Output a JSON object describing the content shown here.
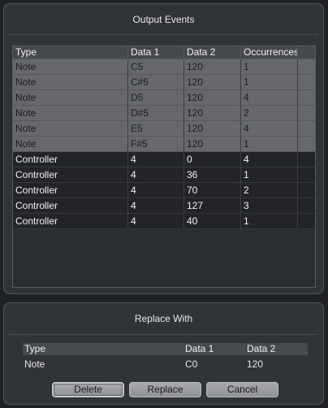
{
  "output_events": {
    "title": "Output Events",
    "columns": [
      "Type",
      "Data 1",
      "Data 2",
      "Occurrences"
    ],
    "rows": [
      {
        "type": "Note",
        "data1": "C5",
        "data2": "120",
        "occurrences": "1"
      },
      {
        "type": "Note",
        "data1": "C#5",
        "data2": "120",
        "occurrences": "1"
      },
      {
        "type": "Note",
        "data1": "D5",
        "data2": "120",
        "occurrences": "4"
      },
      {
        "type": "Note",
        "data1": "D#5",
        "data2": "120",
        "occurrences": "2"
      },
      {
        "type": "Note",
        "data1": "E5",
        "data2": "120",
        "occurrences": "4"
      },
      {
        "type": "Note",
        "data1": "F#5",
        "data2": "120",
        "occurrences": "1"
      },
      {
        "type": "Controller",
        "data1": "4",
        "data2": "0",
        "occurrences": "4"
      },
      {
        "type": "Controller",
        "data1": "4",
        "data2": "36",
        "occurrences": "1"
      },
      {
        "type": "Controller",
        "data1": "4",
        "data2": "70",
        "occurrences": "2"
      },
      {
        "type": "Controller",
        "data1": "4",
        "data2": "127",
        "occurrences": "3"
      },
      {
        "type": "Controller",
        "data1": "4",
        "data2": "40",
        "occurrences": "1"
      }
    ]
  },
  "replace_with": {
    "title": "Replace With",
    "columns": [
      "Type",
      "Data 1",
      "Data 2"
    ],
    "row": {
      "type": "Note",
      "data1": "C0",
      "data2": "120"
    }
  },
  "buttons": {
    "delete": "Delete",
    "replace": "Replace",
    "cancel": "Cancel"
  }
}
